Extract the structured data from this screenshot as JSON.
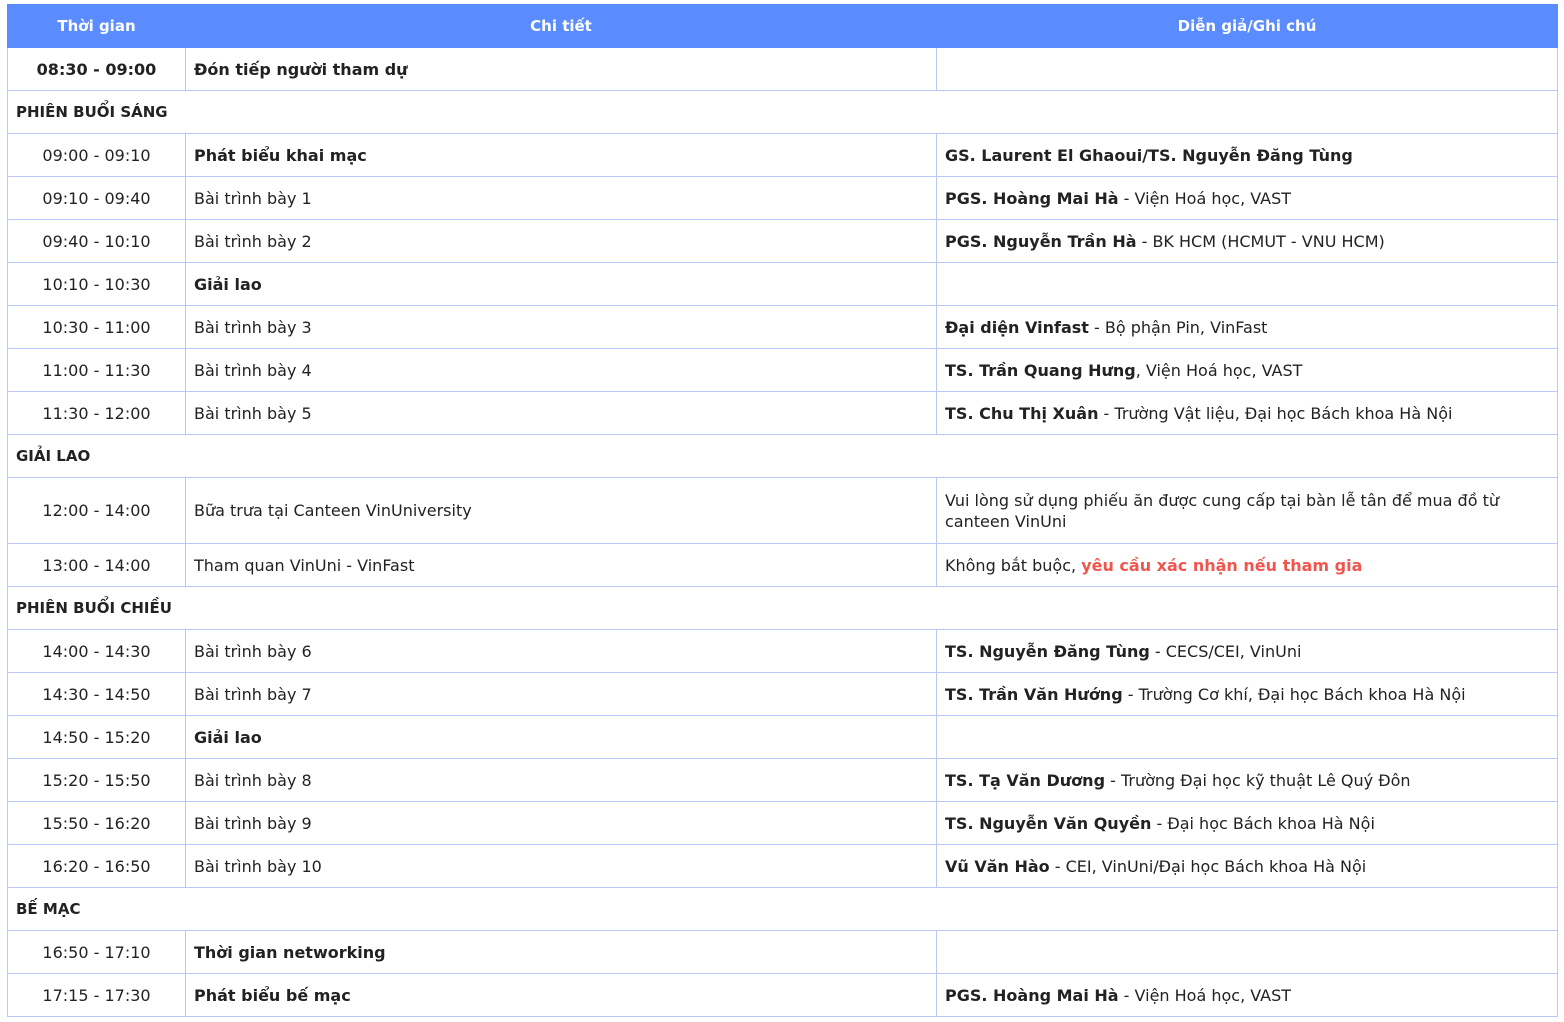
{
  "header": {
    "time": "Thời gian",
    "detail": "Chi tiết",
    "speaker": "Diễn giả/Ghi chú"
  },
  "rows": [
    {
      "time": "08:30 - 09:00",
      "detail": "Đón tiếp người tham dự",
      "speaker_bold": "",
      "speaker_rest": ""
    },
    {
      "section": "PHIÊN BUỔI SÁNG"
    },
    {
      "time": "09:00 - 09:10",
      "detail": "Phát biểu khai mạc",
      "speaker_bold": "GS. Laurent El Ghaoui/TS. Nguyễn Đăng Tùng",
      "speaker_rest": ""
    },
    {
      "time": "09:10 - 09:40",
      "detail": "Bài trình bày 1",
      "speaker_bold": "PGS. Hoàng Mai Hà",
      "speaker_rest": " - Viện Hoá học, VAST"
    },
    {
      "time": "09:40 - 10:10",
      "detail": "Bài trình bày 2",
      "speaker_bold": "PGS. Nguyễn Trần Hà",
      "speaker_rest": " - BK HCM (HCMUT - VNU HCM)"
    },
    {
      "time": "10:10 - 10:30",
      "detail": "Giải lao",
      "speaker_bold": "",
      "speaker_rest": ""
    },
    {
      "time": "10:30 - 11:00",
      "detail": "Bài trình bày 3",
      "speaker_bold": "Đại diện Vinfast",
      "speaker_rest": " - Bộ phận Pin, VinFast"
    },
    {
      "time": "11:00 - 11:30",
      "detail": "Bài trình bày 4",
      "speaker_bold": "TS. Trần Quang Hưng",
      "speaker_rest": ", Viện Hoá học, VAST"
    },
    {
      "time": "11:30 - 12:00",
      "detail": "Bài trình bày 5",
      "speaker_bold": "TS. Chu Thị Xuân",
      "speaker_rest": " - Trường Vật liệu, Đại học Bách khoa Hà Nội"
    },
    {
      "section": "GIẢI LAO"
    },
    {
      "time": "12:00 - 14:00",
      "detail": "Bữa trưa tại Canteen VinUniversity",
      "speaker_bold": "",
      "speaker_rest": "Vui lòng sử dụng phiếu ăn được cung cấp tại bàn lễ tân để mua đồ từ canteen VinUni"
    },
    {
      "time": "13:00 - 14:00",
      "detail": "Tham quan VinUni - VinFast",
      "speaker_bold": "",
      "speaker_rest": "Không bắt buộc, ",
      "speaker_warn": "yêu cầu xác nhận nếu tham gia"
    },
    {
      "section": "PHIÊN BUỔI CHIỀU"
    },
    {
      "time": "14:00 - 14:30",
      "detail": "Bài trình bày 6",
      "speaker_bold": "TS. Nguyễn Đăng Tùng",
      "speaker_rest": " - CECS/CEI, VinUni"
    },
    {
      "time": "14:30 - 14:50",
      "detail": "Bài trình bày 7",
      "speaker_bold": "TS. Trần Văn Hướng",
      "speaker_rest": " - Trường Cơ khí, Đại học Bách khoa Hà Nội"
    },
    {
      "time": "14:50 - 15:20",
      "detail": "Giải lao",
      "speaker_bold": "",
      "speaker_rest": ""
    },
    {
      "time": "15:20 - 15:50",
      "detail": "Bài trình bày 8",
      "speaker_bold": "TS. Tạ Văn Dương",
      "speaker_rest": " - Trường Đại học kỹ thuật Lê Quý Đôn"
    },
    {
      "time": "15:50 - 16:20",
      "detail": "Bài trình bày 9",
      "speaker_bold": "TS. Nguyễn Văn Quyền",
      "speaker_rest": " - Đại học Bách khoa Hà Nội"
    },
    {
      "time": "16:20 - 16:50",
      "detail": "Bài trình bày 10",
      "speaker_bold": "Vũ Văn Hào",
      "speaker_rest": " - CEI, VinUni/Đại học Bách khoa Hà Nội"
    },
    {
      "section": "BẾ MẠC"
    },
    {
      "time": "16:50 - 17:10",
      "detail": "Thời gian networking",
      "speaker_bold": "",
      "speaker_rest": ""
    },
    {
      "time": "17:15 - 17:30",
      "detail": "Phát biểu bế mạc",
      "speaker_bold": "PGS. Hoàng Mai Hà",
      "speaker_rest": " - Viện Hoá học, VAST"
    }
  ]
}
